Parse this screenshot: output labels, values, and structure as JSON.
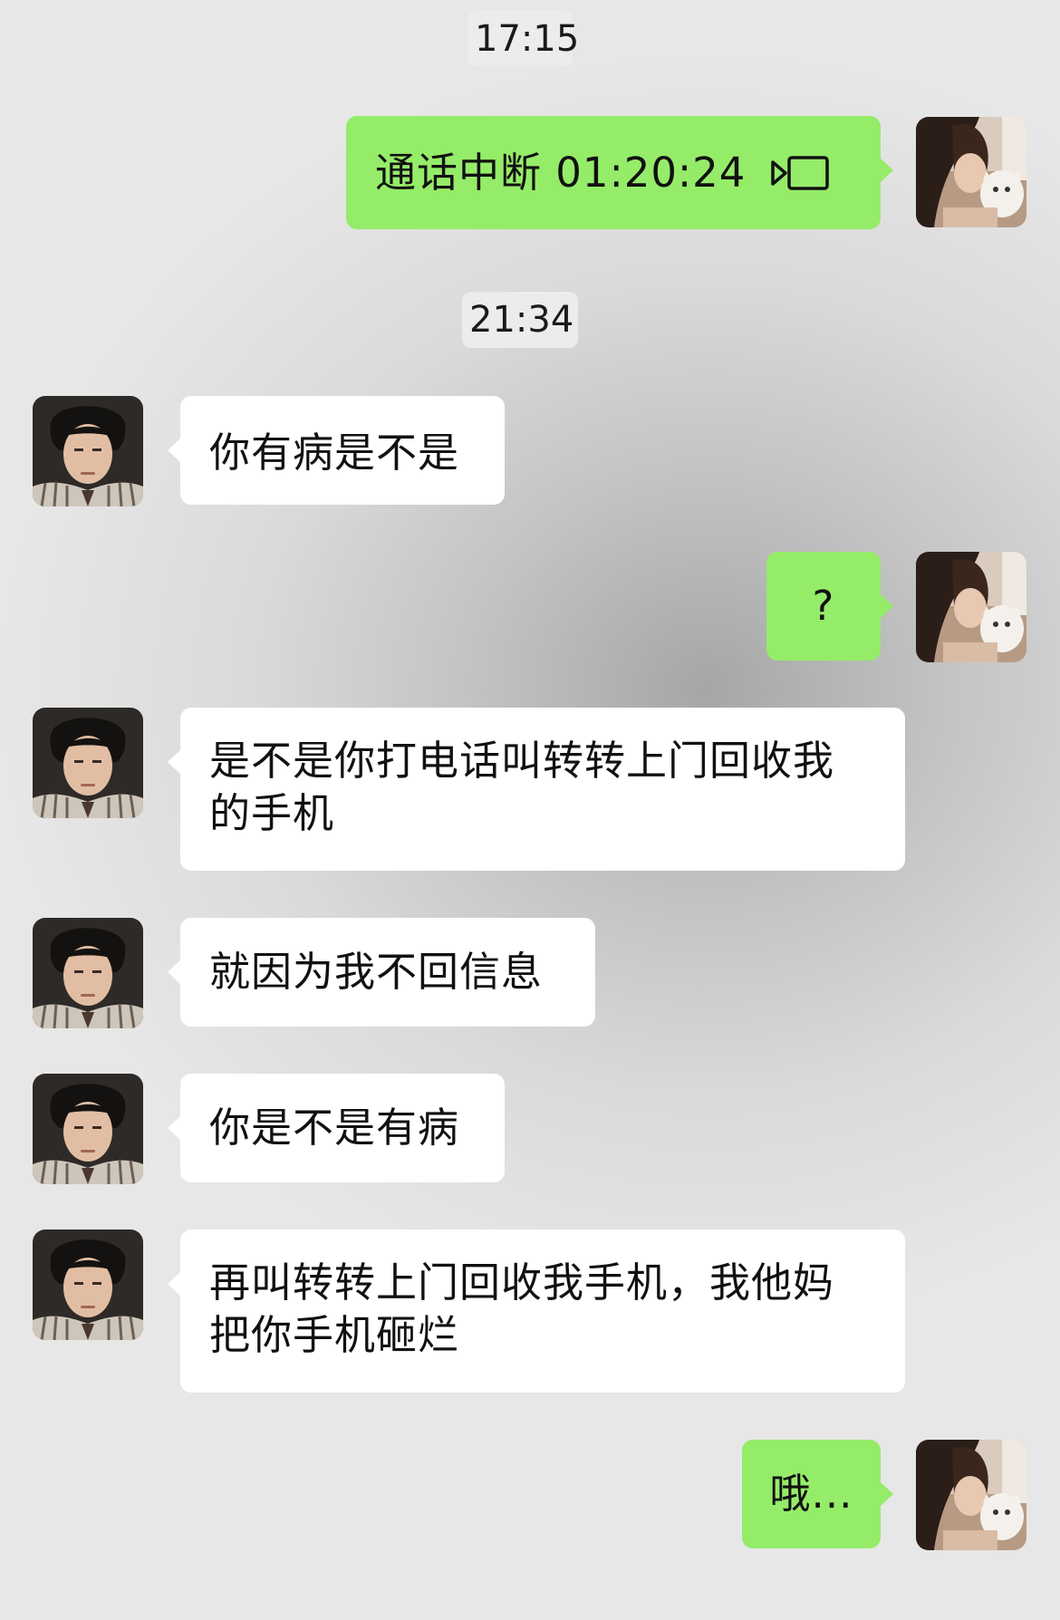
{
  "timestamps": [
    "17:15",
    "21:34"
  ],
  "messages": [
    {
      "side": "out",
      "type": "call",
      "text": "通话中断 01:20:24",
      "icon": "video-call-icon"
    },
    {
      "side": "in",
      "text": "你有病是不是"
    },
    {
      "side": "out",
      "text": "?"
    },
    {
      "side": "in",
      "line1": "是不是你打电话叫转转上门回收我",
      "line2": "的手机"
    },
    {
      "side": "in",
      "text": "就因为我不回信息"
    },
    {
      "side": "in",
      "text": "你是不是有病"
    },
    {
      "side": "in",
      "line1": "再叫转转上门回收我手机，我他妈",
      "line2": "把你手机砸烂"
    },
    {
      "side": "out",
      "text": "哦..."
    }
  ],
  "colors": {
    "outgoing_bubble": "#95ec69",
    "incoming_bubble": "#ffffff",
    "time_pill": "#ececec"
  }
}
